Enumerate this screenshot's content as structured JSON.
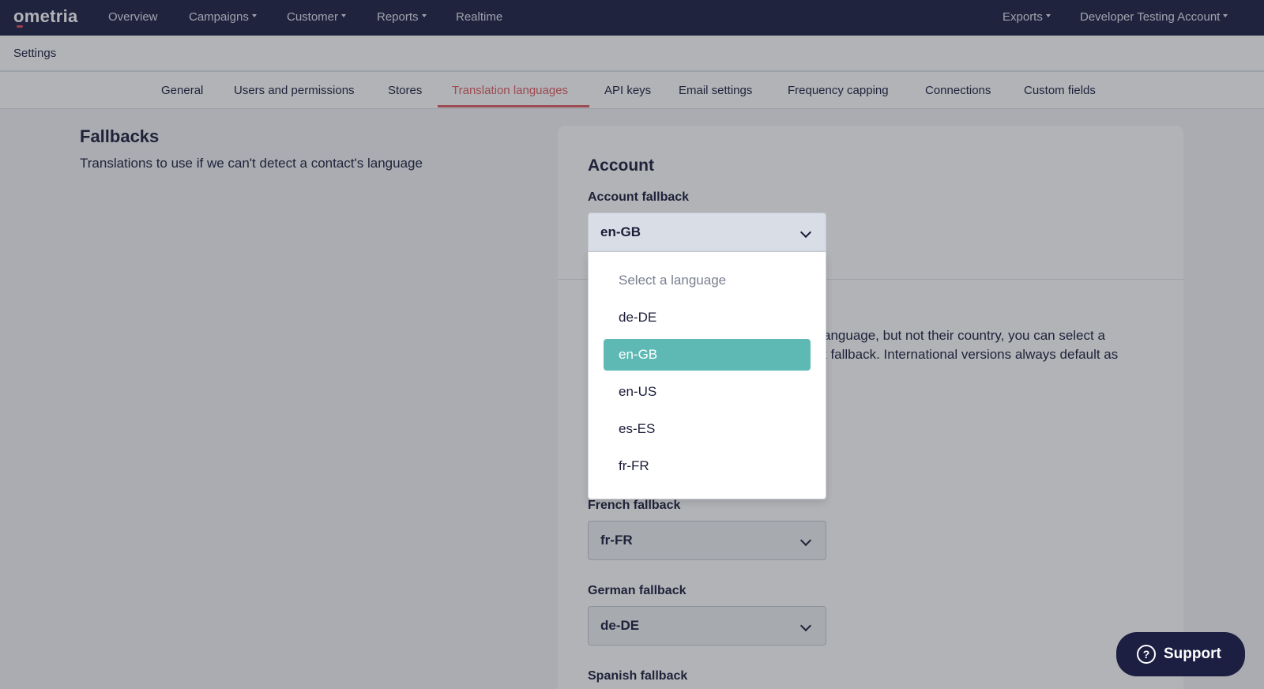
{
  "nav": {
    "logo": "ometria",
    "items": [
      {
        "label": "Overview",
        "dropdown": false
      },
      {
        "label": "Campaigns",
        "dropdown": true
      },
      {
        "label": "Customer",
        "dropdown": true
      },
      {
        "label": "Reports",
        "dropdown": true
      },
      {
        "label": "Realtime",
        "dropdown": false
      }
    ],
    "right": [
      {
        "label": "Exports",
        "dropdown": true
      },
      {
        "label": "Developer Testing Account",
        "dropdown": true
      }
    ]
  },
  "settings": {
    "title": "Settings"
  },
  "tabs": [
    {
      "label": "General"
    },
    {
      "label": "Users and permissions"
    },
    {
      "label": "Stores"
    },
    {
      "label": "Translation languages",
      "active": true
    },
    {
      "label": "API keys"
    },
    {
      "label": "Email settings"
    },
    {
      "label": "Frequency capping"
    },
    {
      "label": "Connections"
    },
    {
      "label": "Custom fields"
    }
  ],
  "fallbacks": {
    "title": "Fallbacks",
    "subtitle": "Translations to use if we can't detect a contact's language"
  },
  "card": {
    "account_title": "Account",
    "account_fallback_label": "Account fallback",
    "account_fallback_value": "en-GB",
    "partial_text_line1": "anguage, but not their country, you can select a",
    "partial_text_line2": "t fallback. International versions always default as",
    "french_label": "French fallback",
    "french_value": "fr-FR",
    "german_label": "German fallback",
    "german_value": "de-DE",
    "spanish_label": "Spanish fallback"
  },
  "dropdown": {
    "placeholder": "Select a language",
    "options": [
      "de-DE",
      "en-GB",
      "en-US",
      "es-ES",
      "fr-FR"
    ],
    "selected": "en-GB"
  },
  "support": {
    "label": "Support"
  },
  "colors": {
    "nav_bg": "#1c1f42",
    "active_tab": "#e05d61",
    "selected_option": "#5eb9b5"
  }
}
